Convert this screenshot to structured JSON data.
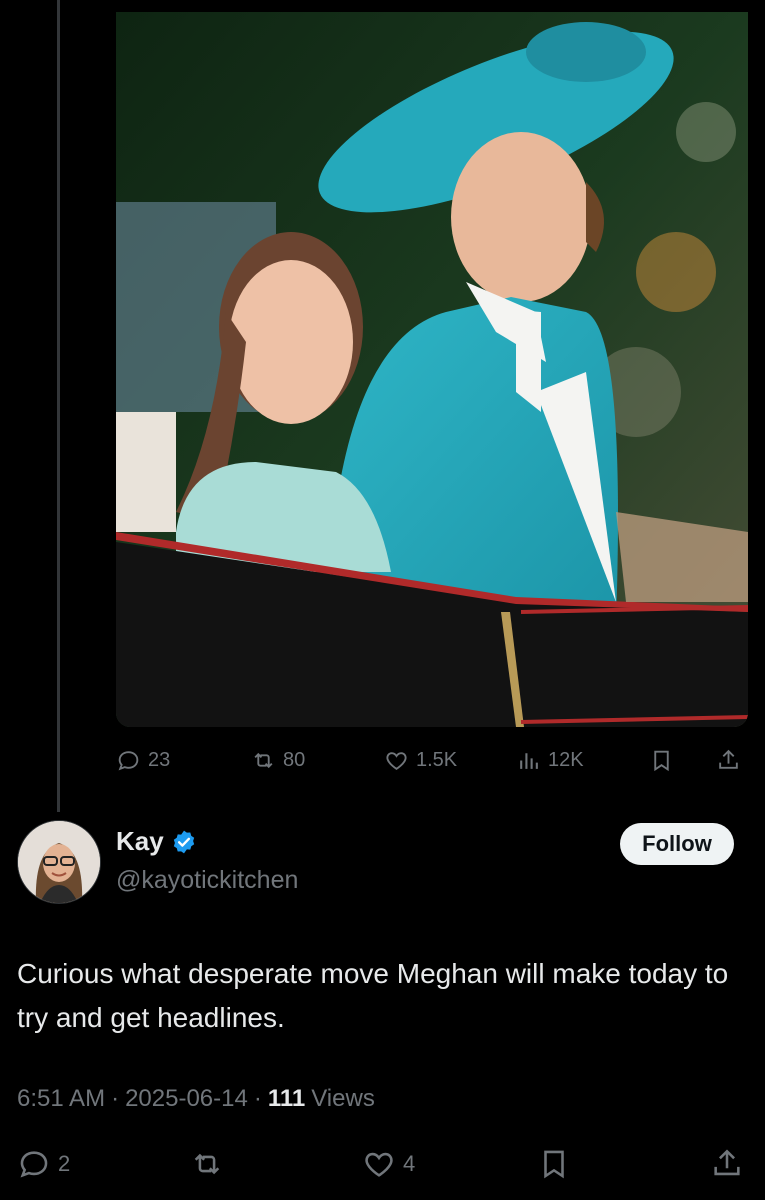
{
  "quoted_media": {
    "description_icon": "photo"
  },
  "quoted_actions": {
    "replies": "23",
    "reposts": "80",
    "likes": "1.5K",
    "views": "12K"
  },
  "author": {
    "name": "Kay",
    "handle": "@kayotickitchen",
    "verified": true,
    "follow_label": "Follow"
  },
  "tweet": {
    "text": "Curious what desperate move Meghan will make today to try and get headlines."
  },
  "meta": {
    "time": "6:51 AM",
    "date": "2025-06-14",
    "views_count": "111",
    "views_label": "Views"
  },
  "bottom_actions": {
    "replies": "2",
    "reposts": "",
    "likes": "4"
  },
  "colors": {
    "background": "#000000",
    "text": "#e7e9ea",
    "muted": "#71767b",
    "verified": "#1d9bf0"
  }
}
